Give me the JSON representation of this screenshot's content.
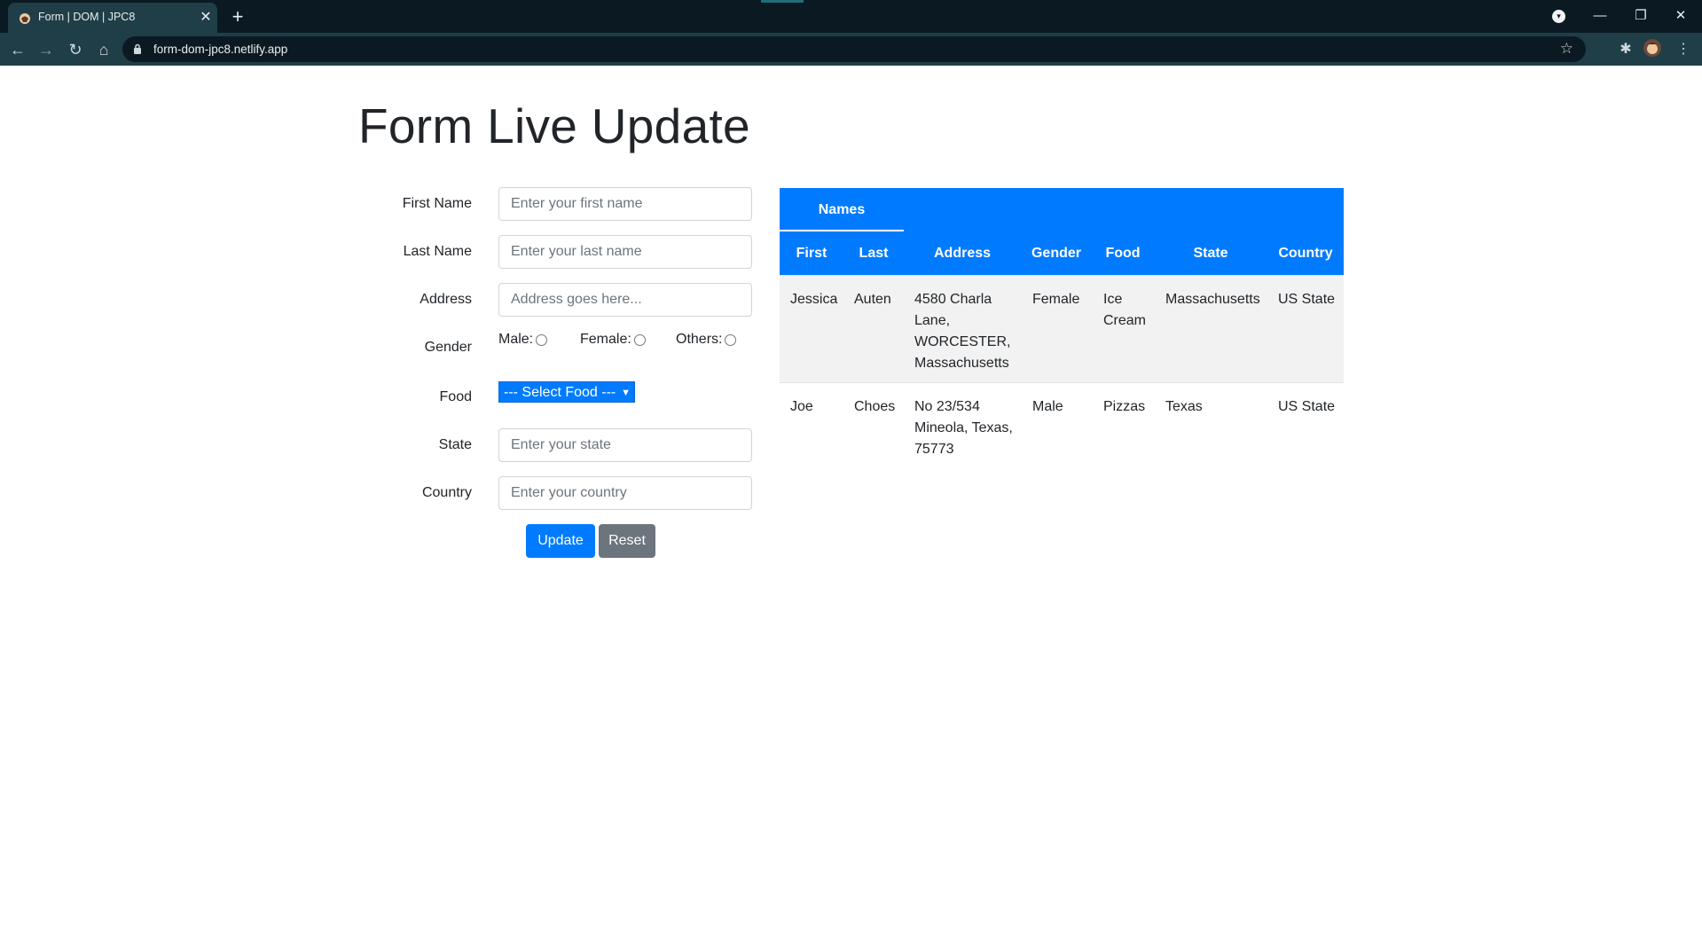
{
  "browser": {
    "tab_title": "Form | DOM | JPC8",
    "tab_close": "✕",
    "new_tab": "+",
    "url": "form-dom-jpc8.netlify.app",
    "window_minimize": "—",
    "window_restore": "❐",
    "window_close": "✕"
  },
  "page": {
    "title": "Form Live Update"
  },
  "form": {
    "first_name_label": "First Name",
    "first_name_placeholder": "Enter your first name",
    "last_name_label": "Last Name",
    "last_name_placeholder": "Enter your last name",
    "address_label": "Address",
    "address_placeholder": "Address goes here...",
    "gender_label": "Gender",
    "gender_options": [
      "Male:",
      "Female:",
      "Others:"
    ],
    "food_label": "Food",
    "food_select_value": "--- Select Food ---",
    "state_label": "State",
    "state_placeholder": "Enter your state",
    "country_label": "Country",
    "country_placeholder": "Enter your country",
    "update_label": "Update",
    "reset_label": "Reset"
  },
  "table": {
    "group_header": "Names",
    "columns": [
      "First",
      "Last",
      "Address",
      "Gender",
      "Food",
      "State",
      "Country"
    ],
    "rows": [
      {
        "first": "Jessica",
        "last": "Auten",
        "address_lines": [
          "4580 Charla",
          "Lane,",
          "WORCESTER,",
          "Massachusetts"
        ],
        "gender": "Female",
        "food_lines": [
          "Ice",
          "Cream"
        ],
        "state": "Massachusetts",
        "country": "US State"
      },
      {
        "first": "Joe",
        "last": "Choes",
        "address_lines": [
          "No 23/534",
          "Mineola, Texas,",
          "75773"
        ],
        "gender": "Male",
        "food_lines": [
          "Pizzas"
        ],
        "state": "Texas",
        "country": "US State"
      }
    ]
  },
  "colors": {
    "primary": "#007bff",
    "secondary": "#6c757d",
    "chrome_dark": "#0b1a22",
    "chrome_toolbar": "#1f3e48"
  }
}
